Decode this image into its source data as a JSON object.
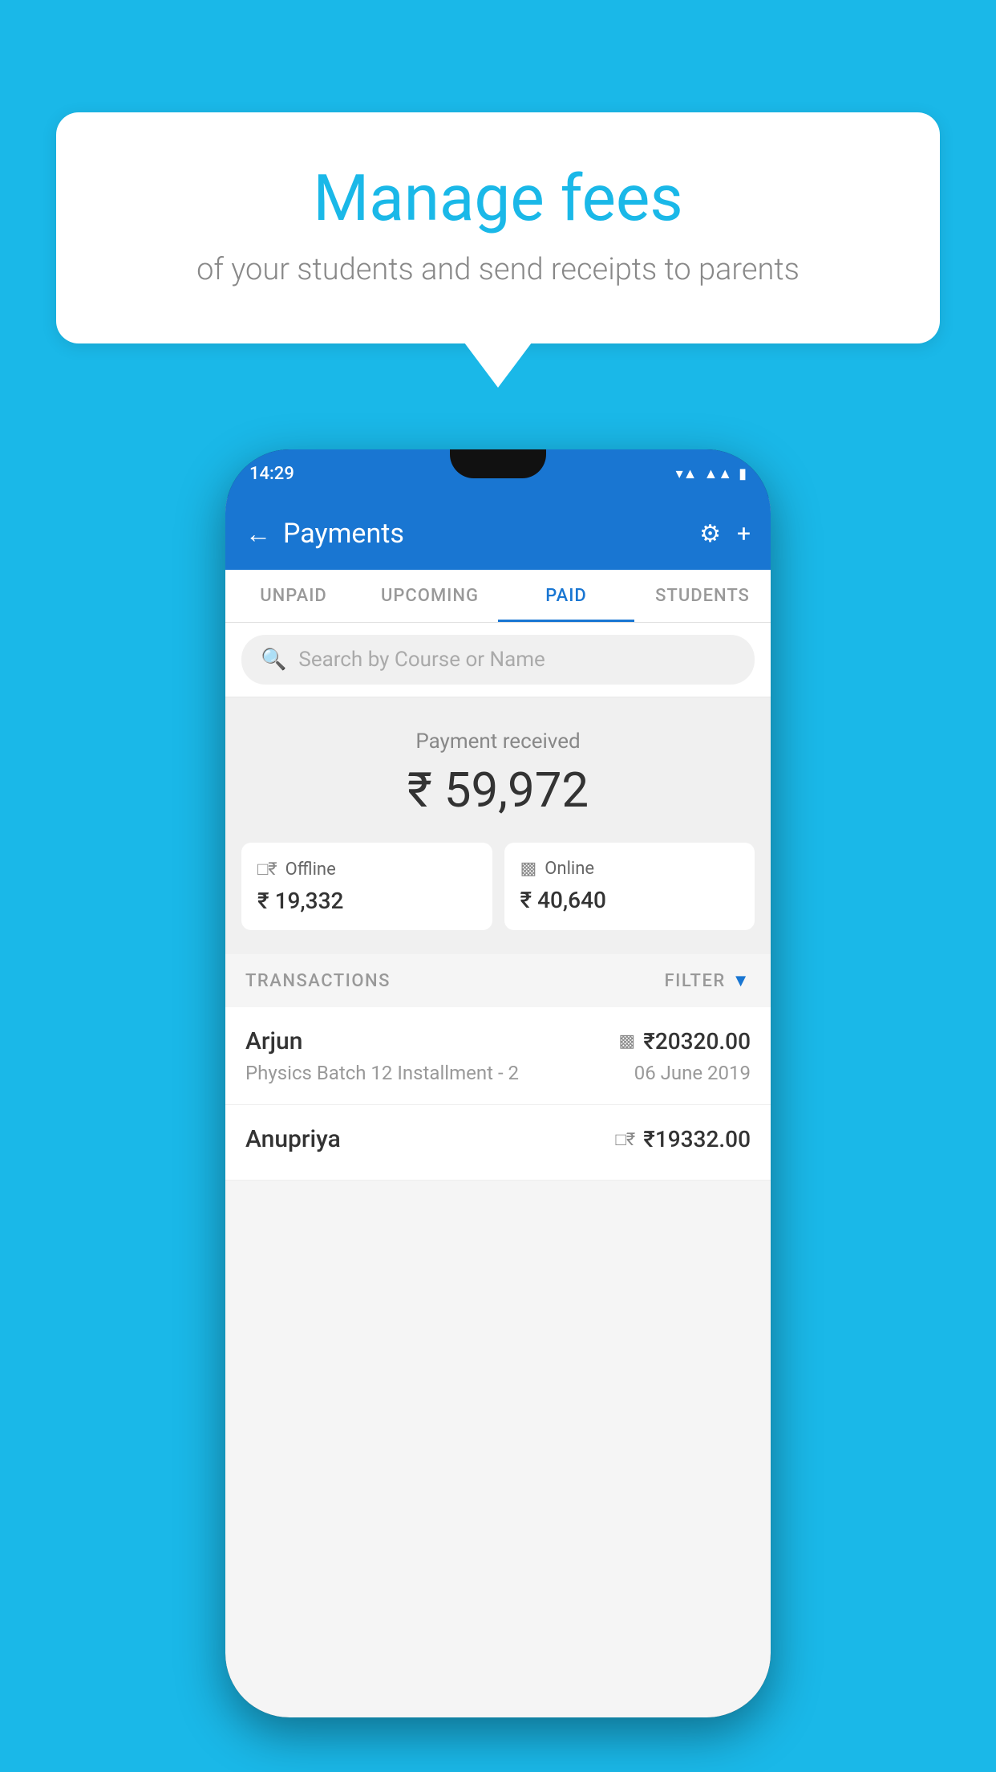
{
  "background_color": "#1ab8e8",
  "speech_bubble": {
    "title": "Manage fees",
    "subtitle": "of your students and send receipts to parents"
  },
  "phone": {
    "status_bar": {
      "time": "14:29"
    },
    "header": {
      "back_label": "←",
      "title": "Payments",
      "settings_icon": "⚙",
      "add_icon": "+"
    },
    "tabs": [
      {
        "label": "UNPAID",
        "active": false
      },
      {
        "label": "UPCOMING",
        "active": false
      },
      {
        "label": "PAID",
        "active": true
      },
      {
        "label": "STUDENTS",
        "active": false
      }
    ],
    "search": {
      "placeholder": "Search by Course or Name"
    },
    "payment_summary": {
      "label": "Payment received",
      "amount": "₹ 59,972",
      "offline": {
        "label": "Offline",
        "amount": "₹ 19,332"
      },
      "online": {
        "label": "Online",
        "amount": "₹ 40,640"
      }
    },
    "transactions": {
      "label": "TRANSACTIONS",
      "filter_label": "FILTER",
      "rows": [
        {
          "name": "Arjun",
          "amount": "₹20320.00",
          "payment_type": "online",
          "course": "Physics Batch 12 Installment - 2",
          "date": "06 June 2019"
        },
        {
          "name": "Anupriya",
          "amount": "₹19332.00",
          "payment_type": "offline",
          "course": "",
          "date": ""
        }
      ]
    }
  }
}
